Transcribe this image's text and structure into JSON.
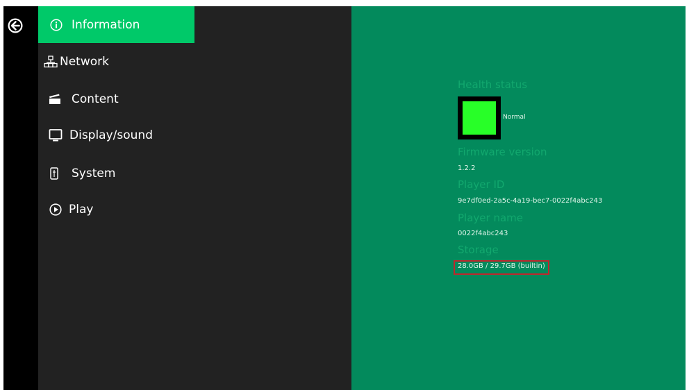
{
  "sidebar": {
    "items": [
      {
        "label": "Information",
        "icon": "info-circle-icon",
        "active": true
      },
      {
        "label": "Network",
        "icon": "network-icon",
        "active": false
      },
      {
        "label": "Content",
        "icon": "clapperboard-icon",
        "active": false
      },
      {
        "label": "Display/sound",
        "icon": "monitor-icon",
        "active": false
      },
      {
        "label": "System",
        "icon": "system-icon",
        "active": false
      },
      {
        "label": "Play",
        "icon": "play-circle-icon",
        "active": false
      }
    ]
  },
  "info": {
    "health_heading": "Health status",
    "health_value": "Normal",
    "firmware_heading": "Firmware version",
    "firmware_value": "1.2.2",
    "player_id_heading": "Player ID",
    "player_id_value": "9e7df0ed-2a5c-4a19-bec7-0022f4abc243",
    "player_name_heading": "Player name",
    "player_name_value": "0022f4abc243",
    "storage_heading": "Storage",
    "storage_value": "28.0GB / 29.7GB (builtin)"
  },
  "colors": {
    "active_menu": "#00c969",
    "panel_background": "#038a5c",
    "sidebar_background": "#222222",
    "health_indicator": "#28ff28",
    "highlight_border": "#c0262c"
  }
}
